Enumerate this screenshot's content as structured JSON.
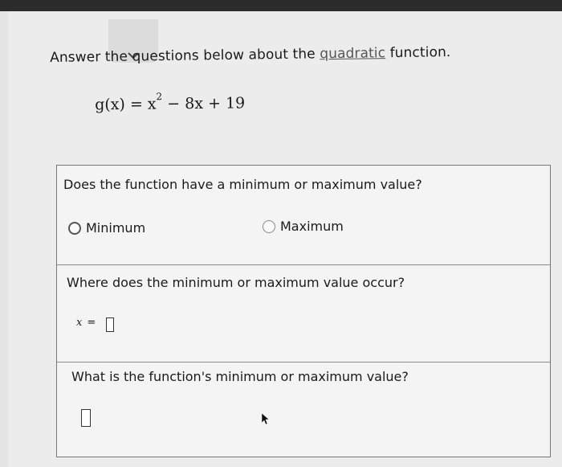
{
  "instruction": {
    "prefix": "Answer the questions below about the",
    "link": "quadratic",
    "suffix": "function."
  },
  "equation": {
    "lhs": "g(x)",
    "equals": "=",
    "x_term": "x",
    "exponent": "2",
    "rest": "− 8x + 19"
  },
  "questions": {
    "q1": {
      "text": "Does the function have a minimum or maximum value?",
      "options": [
        "Minimum",
        "Maximum"
      ]
    },
    "q2": {
      "text": "Where does the minimum or maximum value occur?",
      "var_label": "x",
      "equals": "="
    },
    "q3": {
      "text": "What is the function's minimum or maximum value?"
    }
  },
  "icons": {
    "collapse": "chevron-down-icon",
    "cursor": "mouse-pointer-icon"
  },
  "colors": {
    "panel_border": "#777777",
    "link": "#555555"
  }
}
